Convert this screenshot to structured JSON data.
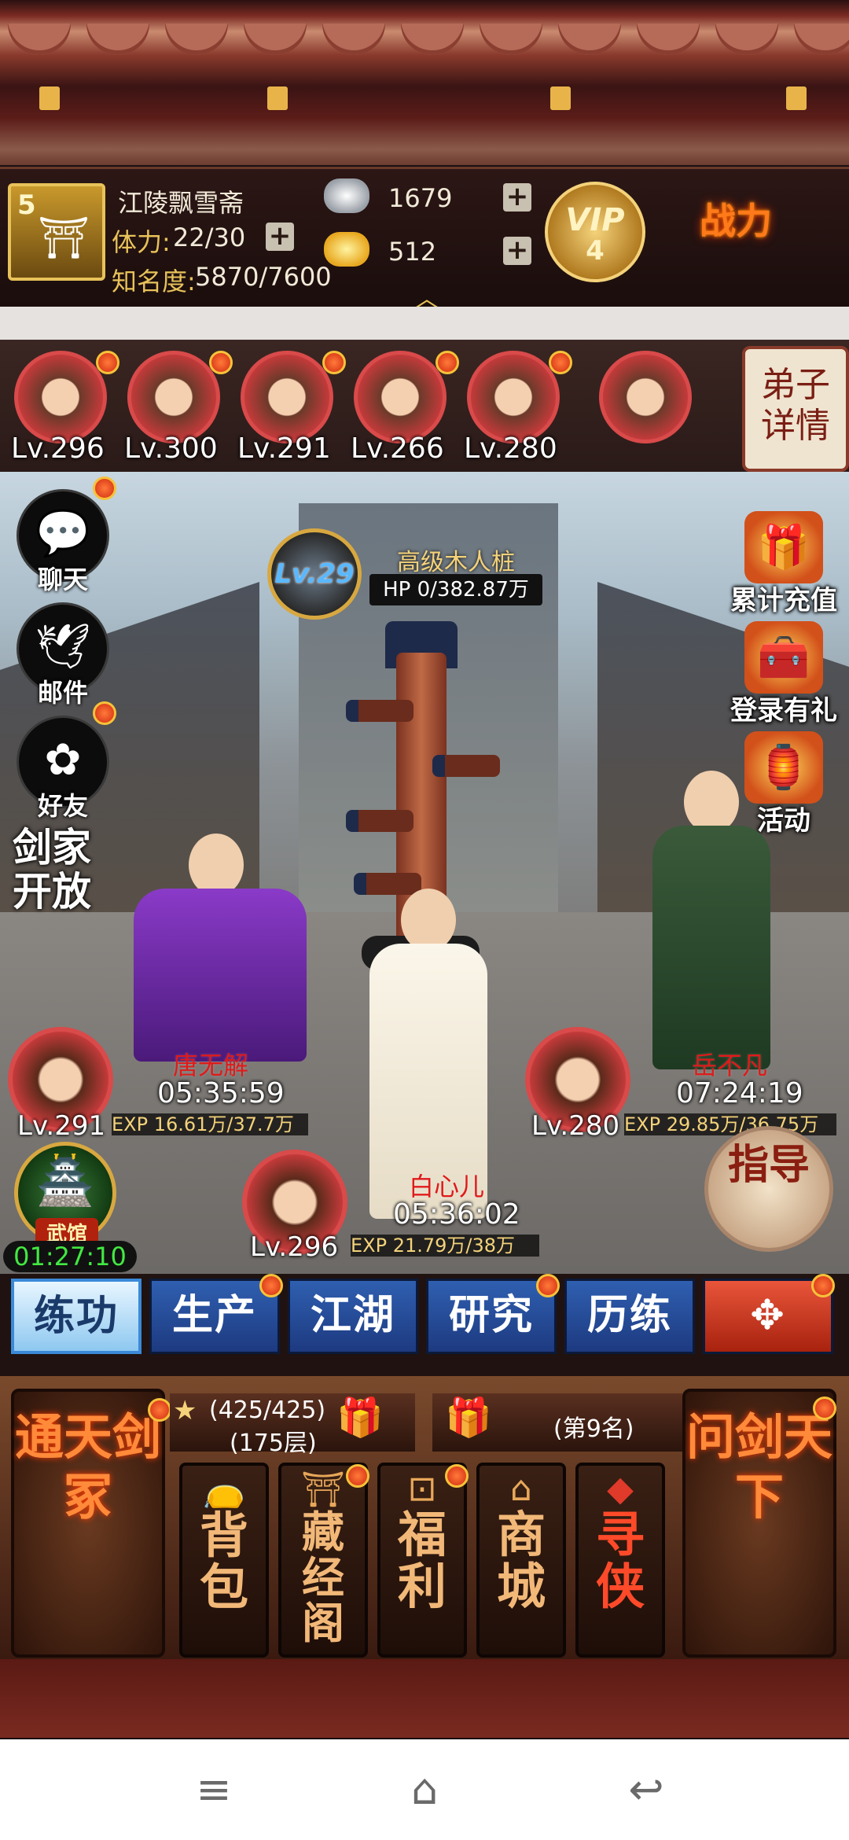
{
  "header": {
    "rank": "5",
    "player_name": "江陵飘雪斋",
    "stamina_label": "体力:",
    "stamina_value": "22/30",
    "fame_label": "知名度:",
    "fame_value": "5870/7600",
    "silver": "1679",
    "gold": "512",
    "vip_label": "VIP",
    "vip_level": "4",
    "power_label": "战力"
  },
  "disciples": [
    {
      "level": "Lv.296"
    },
    {
      "level": "Lv.300"
    },
    {
      "level": "Lv.291"
    },
    {
      "level": "Lv.266"
    },
    {
      "level": "Lv.280"
    },
    {
      "level": ""
    }
  ],
  "disciple_detail_label": "弟子详情",
  "side_left": [
    {
      "label": "聊天",
      "icon": "chat-icon"
    },
    {
      "label": "邮件",
      "icon": "mail-icon"
    },
    {
      "label": "好友",
      "icon": "friends-icon"
    }
  ],
  "jianjia_label": "剑家开放",
  "side_right": [
    {
      "label": "累计充值",
      "icon": "recharge-gift-icon"
    },
    {
      "label": "登录有礼",
      "icon": "login-gift-icon"
    },
    {
      "label": "活动",
      "icon": "event-icon"
    }
  ],
  "boss": {
    "level": "Lv.29",
    "name": "高级木人桩",
    "hp": "HP 0/382.87万"
  },
  "slots": {
    "left": {
      "name": "唐无解",
      "timer": "05:35:59",
      "level": "Lv.291",
      "exp": "EXP 16.61万/37.7万"
    },
    "right": {
      "name": "岳不凡",
      "timer": "07:24:19",
      "level": "Lv.280",
      "exp": "EXP 29.85万/36.75万"
    },
    "center": {
      "name": "白心儿",
      "timer": "05:36:02",
      "level": "Lv.296",
      "exp": "EXP 21.79万/38万"
    }
  },
  "wuguan": {
    "label": "武馆",
    "timer": "01:27:10"
  },
  "guide_label": "指导",
  "tabs": [
    "练功",
    "生产",
    "江湖",
    "研究",
    "历练"
  ],
  "panel": {
    "left_card": "通天剑冢",
    "right_card": "问剑天下",
    "tower_progress": "(425/425)",
    "tower_floor": "(175层)",
    "rank_text": "(第9名)",
    "cards": [
      "背包",
      "藏经阁",
      "福利",
      "商城",
      "寻侠"
    ]
  },
  "colors": {
    "accent_red": "#d94a4a",
    "tab_blue": "#2f5fb0",
    "gold": "#e8c25a",
    "timer_green": "#42e842"
  }
}
